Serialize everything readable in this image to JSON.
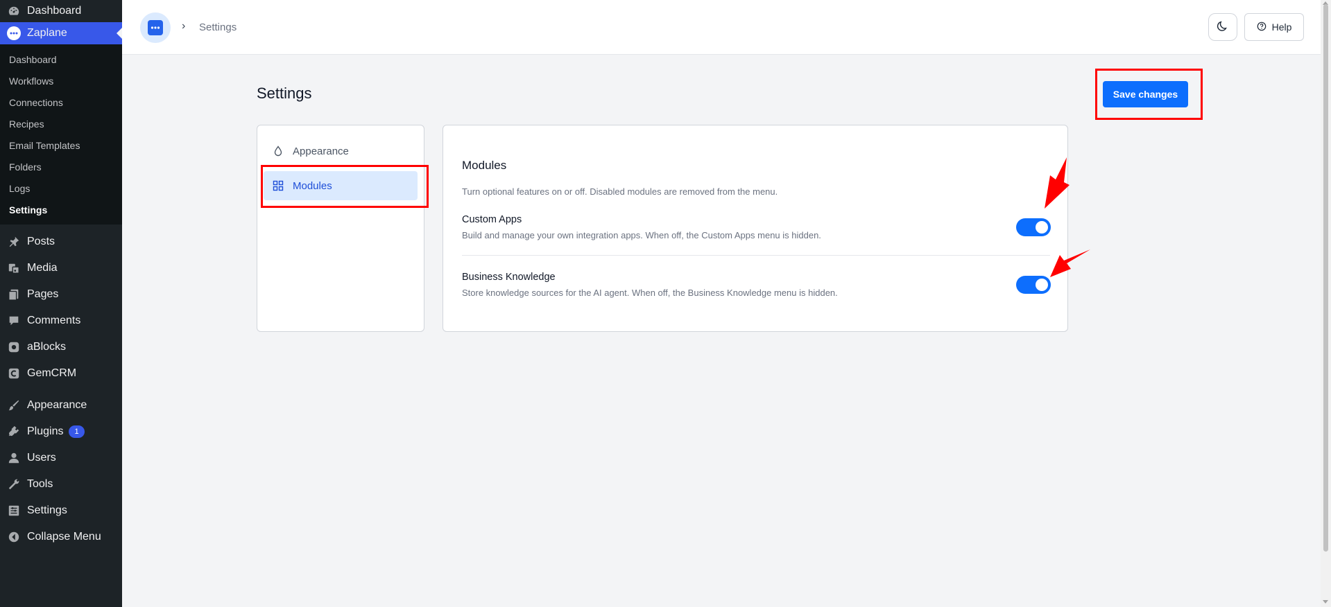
{
  "wp_menu": {
    "dashboard": "Dashboard",
    "zaplane": "Zaplane",
    "zaplane_sub": [
      "Dashboard",
      "Workflows",
      "Connections",
      "Recipes",
      "Email Templates",
      "Folders",
      "Logs",
      "Settings"
    ],
    "posts": "Posts",
    "media": "Media",
    "pages": "Pages",
    "comments": "Comments",
    "ablocks": "aBlocks",
    "gemcrm": "GemCRM",
    "appearance": "Appearance",
    "plugins": "Plugins",
    "plugins_badge": "1",
    "users": "Users",
    "tools": "Tools",
    "settings": "Settings",
    "collapse": "Collapse Menu"
  },
  "header": {
    "breadcrumb_current": "Settings",
    "help_label": "Help"
  },
  "page": {
    "title": "Settings",
    "save_label": "Save changes"
  },
  "settings_nav": {
    "items": [
      "Appearance",
      "Modules"
    ],
    "active": "Modules"
  },
  "modules": {
    "heading": "Modules",
    "description": "Turn optional features on or off. Disabled modules are removed from the menu.",
    "items": [
      {
        "title": "Custom Apps",
        "desc": "Build and manage your own integration apps. When off, the Custom Apps menu is hidden.",
        "enabled": true
      },
      {
        "title": "Business Knowledge",
        "desc": "Store knowledge sources for the AI agent. When off, the Business Knowledge menu is hidden.",
        "enabled": true
      }
    ]
  },
  "colors": {
    "primary": "#0d6efd",
    "wp_sidebar": "#1d2327",
    "wp_accent": "#3858e9",
    "annotation": "#ff0000"
  }
}
